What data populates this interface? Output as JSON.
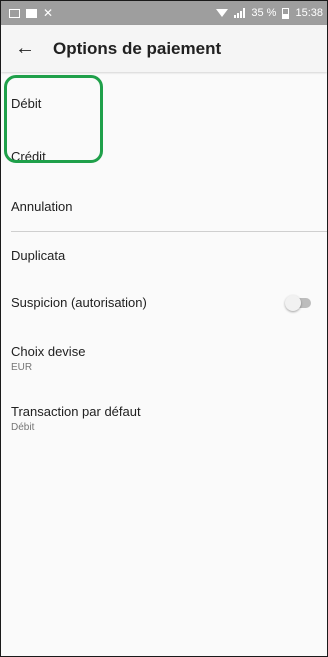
{
  "status_bar": {
    "battery_percent": "35 %",
    "time": "15:38",
    "icons": [
      "square-notification-icon",
      "image-notification-icon",
      "x-notification-icon",
      "wifi-icon",
      "signal-icon",
      "battery-icon"
    ]
  },
  "app_bar": {
    "back_icon": "arrow-left-icon",
    "title": "Options de paiement"
  },
  "items": {
    "debit": {
      "label": "Débit"
    },
    "credit": {
      "label": "Crédit"
    },
    "annulation": {
      "label": "Annulation"
    },
    "duplicata": {
      "label": "Duplicata"
    },
    "suspicion": {
      "label": "Suspicion (autorisation)",
      "toggle_on": false
    },
    "devise": {
      "label": "Choix devise",
      "value": "EUR"
    },
    "transaction": {
      "label": "Transaction par défaut",
      "value": "Débit"
    }
  },
  "colors": {
    "highlight": "#1fa04a",
    "status_bar": "#9e9e9e",
    "toggle_track_off": "#bdbdbd"
  }
}
